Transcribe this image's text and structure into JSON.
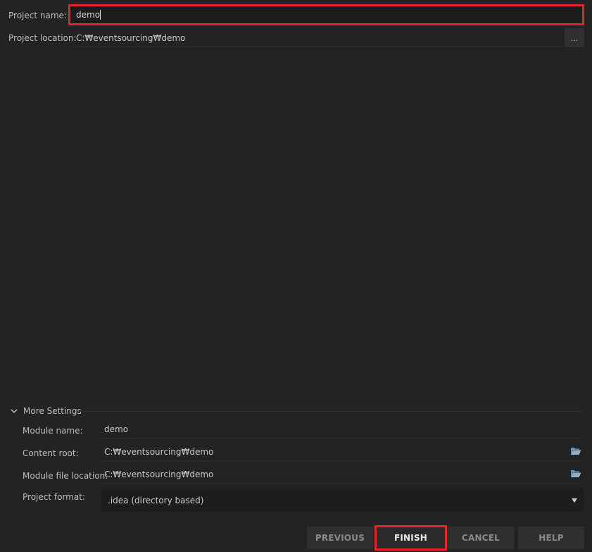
{
  "project": {
    "name_label": "Project name:",
    "name_value": "demo",
    "location_label": "Project location:",
    "location_value": "C:₩eventsourcing₩demo",
    "browse_label": "..."
  },
  "more_settings": {
    "title": "More Settings",
    "module_name_label": "Module name:",
    "module_name_value": "demo",
    "content_root_label": "Content root:",
    "content_root_value": "C:₩eventsourcing₩demo",
    "module_file_location_label": "Module file location:",
    "module_file_location_value": "C:₩eventsourcing₩demo",
    "project_format_label": "Project format:",
    "project_format_value": ".idea (directory based)"
  },
  "buttons": {
    "previous": "PREVIOUS",
    "finish": "FINISH",
    "cancel": "CANCEL",
    "help": "HELP"
  },
  "colors": {
    "background": "#232323",
    "highlight": "#e5232c",
    "icon": "#7f9fb8"
  },
  "icons": {
    "expand": "chevron-down-icon",
    "folder": "folder-open-icon",
    "dropdown": "dropdown-arrow-icon"
  }
}
